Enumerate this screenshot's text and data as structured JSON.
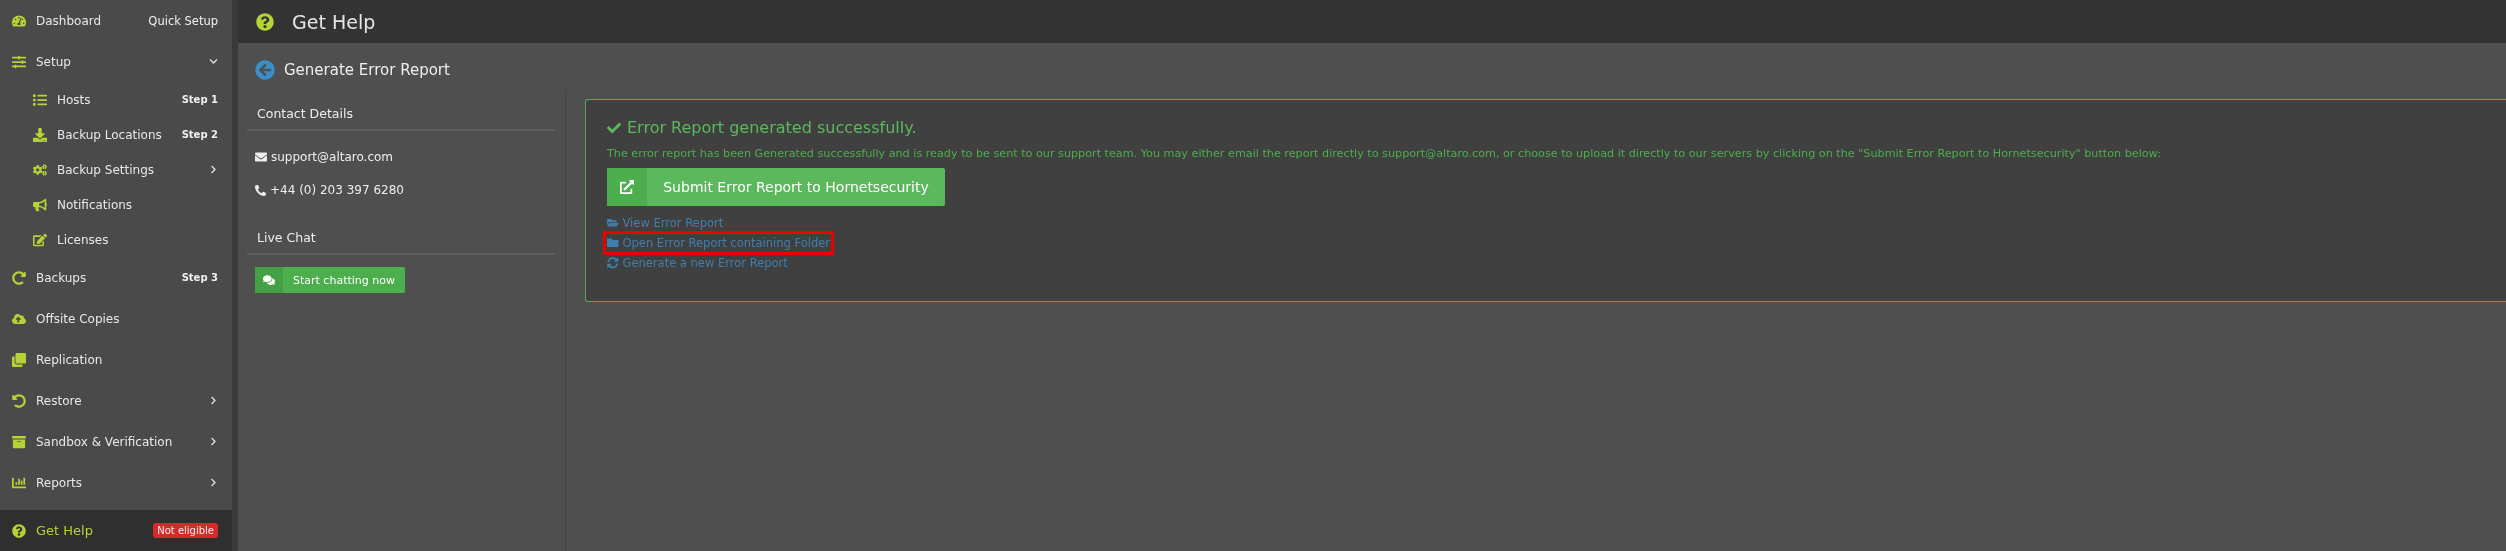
{
  "sidebar": {
    "items": [
      {
        "label": "Dashboard",
        "badge": {
          "text": "Quick Setup",
          "kind": "plain"
        },
        "selected": false
      },
      {
        "label": "Setup",
        "expanded": true,
        "selected": false,
        "children": [
          {
            "label": "Hosts",
            "badge": {
              "text": "Step 1",
              "kind": "step"
            },
            "selected": false
          },
          {
            "label": "Backup Locations",
            "badge": {
              "text": "Step 2",
              "kind": "step"
            },
            "selected": false
          },
          {
            "label": "Backup Settings",
            "expanded": false,
            "selected": false
          },
          {
            "label": "Notifications",
            "selected": false
          },
          {
            "label": "Licenses",
            "selected": false
          }
        ]
      },
      {
        "label": "Backups",
        "badge": {
          "text": "Step 3",
          "kind": "step"
        },
        "selected": false
      },
      {
        "label": "Offsite Copies",
        "selected": false
      },
      {
        "label": "Replication",
        "selected": false
      },
      {
        "label": "Restore",
        "expanded": false,
        "selected": false
      },
      {
        "label": "Sandbox & Verification",
        "expanded": false,
        "selected": false
      },
      {
        "label": "Reports",
        "expanded": false,
        "selected": false
      },
      {
        "label": "Get Help",
        "badge": {
          "text": "Not eligible",
          "kind": "alert"
        },
        "selected": true
      }
    ]
  },
  "header": {
    "title": "Get Help"
  },
  "page": {
    "title": "Generate Error Report"
  },
  "contact": {
    "heading": "Contact Details",
    "email": "support@altaro.com",
    "phone": "+44 (0) 203 397 6280",
    "chat_heading": "Live Chat",
    "chat_button": "Start chatting now"
  },
  "result": {
    "heading": "Error Report generated successfully.",
    "message": "The error report has been Generated successfully and is ready to be sent to our support team. You may either email the report directly to support@altaro.com, or choose to upload it directly to our servers by clicking on the \"Submit Error Report to Hornetsecurity\" button below:",
    "submit_button": "Submit Error Report to Hornetsecurity",
    "links": [
      {
        "label": "View Error Report",
        "highlighted": false
      },
      {
        "label": "Open Error Report containing Folder",
        "highlighted": true
      },
      {
        "label": "Generate a new Error Report",
        "highlighted": false
      }
    ]
  }
}
